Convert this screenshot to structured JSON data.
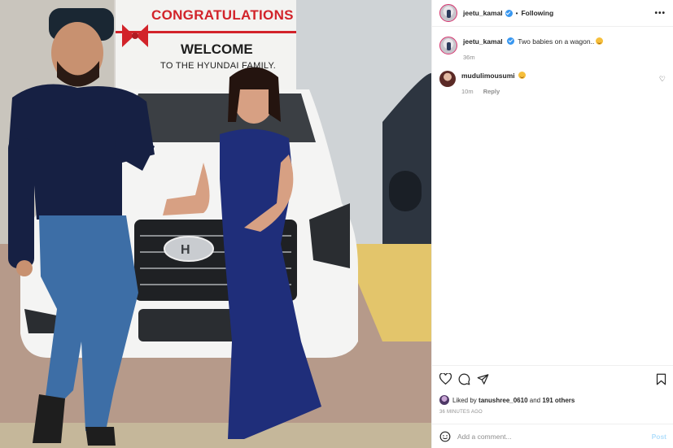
{
  "photo": {
    "banner_line1": "CONGRATULATIONS",
    "banner_line2": "WELCOME",
    "banner_line3": "TO THE HYUNDAI FAMILY."
  },
  "header": {
    "username": "jeetu_kamal",
    "separator": "•",
    "follow_label": "Following",
    "more_icon": "more-horizontal-icon"
  },
  "caption": {
    "username": "jeetu_kamal",
    "text": "Two babies on a wagon..",
    "time": "36m"
  },
  "comments": [
    {
      "username": "mudulimousumi",
      "time": "10m",
      "reply_label": "Reply"
    }
  ],
  "actions": {
    "like_icon": "heart-icon",
    "comment_icon": "comment-icon",
    "share_icon": "send-icon",
    "save_icon": "bookmark-icon"
  },
  "likes": {
    "prefix": "Liked by",
    "user": "tanushree_0610",
    "middle": "and",
    "others": "191 others"
  },
  "timestamp": "36 MINUTES AGO",
  "add_comment": {
    "placeholder": "Add a comment...",
    "post_label": "Post"
  },
  "colors": {
    "verified": "#3897f0",
    "post_disabled": "#b2dffc",
    "banner_red": "#d2232a"
  }
}
